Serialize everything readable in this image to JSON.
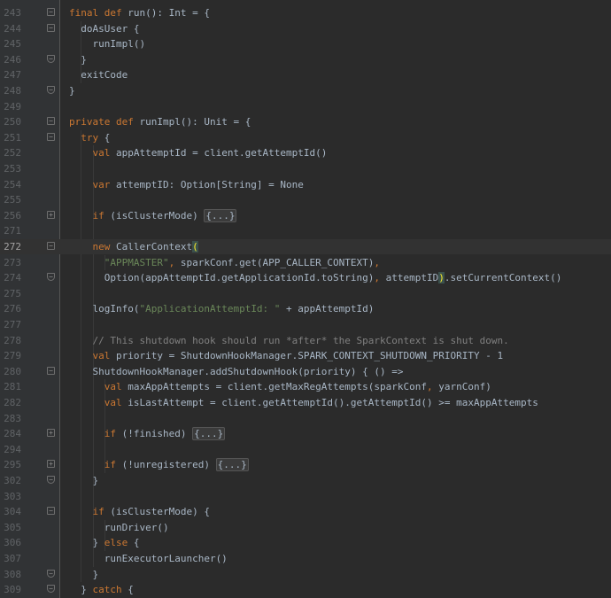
{
  "editor": {
    "lines": [
      {
        "num": "243",
        "fold": "start",
        "tokens": [
          {
            "t": "kw",
            "v": "final def "
          },
          {
            "t": "id",
            "v": "run(): Int = {"
          }
        ]
      },
      {
        "num": "244",
        "fold": "start",
        "tokens": [
          {
            "t": "id",
            "v": "  doAsUser {"
          }
        ]
      },
      {
        "num": "245",
        "fold": "",
        "tokens": [
          {
            "t": "id",
            "v": "    runImpl()"
          }
        ]
      },
      {
        "num": "246",
        "fold": "end",
        "tokens": [
          {
            "t": "id",
            "v": "  }"
          }
        ]
      },
      {
        "num": "247",
        "fold": "",
        "tokens": [
          {
            "t": "id",
            "v": "  exitCode"
          }
        ]
      },
      {
        "num": "248",
        "fold": "end",
        "tokens": [
          {
            "t": "id",
            "v": "}"
          }
        ]
      },
      {
        "num": "249",
        "fold": "",
        "tokens": []
      },
      {
        "num": "250",
        "fold": "start",
        "tokens": [
          {
            "t": "kw",
            "v": "private def "
          },
          {
            "t": "id",
            "v": "runImpl(): Unit = {"
          }
        ]
      },
      {
        "num": "251",
        "fold": "start",
        "tokens": [
          {
            "t": "kw",
            "v": "  try "
          },
          {
            "t": "id",
            "v": "{"
          }
        ]
      },
      {
        "num": "252",
        "fold": "",
        "tokens": [
          {
            "t": "kw",
            "v": "    val "
          },
          {
            "t": "id",
            "v": "appAttemptId = client.getAttemptId()"
          }
        ]
      },
      {
        "num": "253",
        "fold": "",
        "tokens": []
      },
      {
        "num": "254",
        "fold": "",
        "tokens": [
          {
            "t": "kw",
            "v": "    var "
          },
          {
            "t": "id",
            "v": "attemptID: Option[String] = None"
          }
        ]
      },
      {
        "num": "255",
        "fold": "",
        "tokens": []
      },
      {
        "num": "256",
        "fold": "plus",
        "tokens": [
          {
            "t": "kw",
            "v": "    if "
          },
          {
            "t": "id",
            "v": "(isClusterMode) "
          },
          {
            "t": "folded",
            "v": "{...}"
          }
        ]
      },
      {
        "num": "271",
        "fold": "",
        "tokens": []
      },
      {
        "num": "272",
        "fold": "start",
        "current": true,
        "tokens": [
          {
            "t": "kw",
            "v": "    new "
          },
          {
            "t": "id",
            "v": "CallerContext"
          },
          {
            "t": "bracket",
            "v": "("
          }
        ]
      },
      {
        "num": "273",
        "fold": "",
        "tokens": [
          {
            "t": "str",
            "v": "      \"APPMASTER\""
          },
          {
            "t": "kw",
            "v": ", "
          },
          {
            "t": "id",
            "v": "sparkConf.get(APP_CALLER_CONTEXT)"
          },
          {
            "t": "kw",
            "v": ","
          }
        ]
      },
      {
        "num": "274",
        "fold": "end",
        "tokens": [
          {
            "t": "id",
            "v": "      Option(appAttemptId.getApplicationId.toString)"
          },
          {
            "t": "kw",
            "v": ", "
          },
          {
            "t": "id",
            "v": "attemptID"
          },
          {
            "t": "bracket",
            "v": ")"
          },
          {
            "t": "id",
            "v": ".setCurrentContext()"
          }
        ]
      },
      {
        "num": "275",
        "fold": "",
        "tokens": []
      },
      {
        "num": "276",
        "fold": "",
        "tokens": [
          {
            "t": "id",
            "v": "    logInfo("
          },
          {
            "t": "str",
            "v": "\"ApplicationAttemptId: \""
          },
          {
            "t": "id",
            "v": " + appAttemptId)"
          }
        ]
      },
      {
        "num": "277",
        "fold": "",
        "tokens": []
      },
      {
        "num": "278",
        "fold": "",
        "tokens": [
          {
            "t": "cmt",
            "v": "    // This shutdown hook should run *after* the SparkContext is shut down."
          }
        ]
      },
      {
        "num": "279",
        "fold": "",
        "tokens": [
          {
            "t": "kw",
            "v": "    val "
          },
          {
            "t": "id",
            "v": "priority = ShutdownHookManager.SPARK_CONTEXT_SHUTDOWN_PRIORITY - 1"
          }
        ]
      },
      {
        "num": "280",
        "fold": "start",
        "tokens": [
          {
            "t": "id",
            "v": "    ShutdownHookManager.addShutdownHook(priority) { () =>"
          }
        ]
      },
      {
        "num": "281",
        "fold": "",
        "tokens": [
          {
            "t": "kw",
            "v": "      val "
          },
          {
            "t": "id",
            "v": "maxAppAttempts = client.getMaxRegAttempts(sparkConf"
          },
          {
            "t": "kw",
            "v": ", "
          },
          {
            "t": "id",
            "v": "yarnConf)"
          }
        ]
      },
      {
        "num": "282",
        "fold": "",
        "tokens": [
          {
            "t": "kw",
            "v": "      val "
          },
          {
            "t": "id",
            "v": "isLastAttempt = client.getAttemptId().getAttemptId() >= maxAppAttempts"
          }
        ]
      },
      {
        "num": "283",
        "fold": "",
        "tokens": []
      },
      {
        "num": "284",
        "fold": "plus",
        "tokens": [
          {
            "t": "kw",
            "v": "      if "
          },
          {
            "t": "id",
            "v": "(!finished) "
          },
          {
            "t": "folded",
            "v": "{...}"
          }
        ]
      },
      {
        "num": "294",
        "fold": "",
        "tokens": []
      },
      {
        "num": "295",
        "fold": "plus",
        "tokens": [
          {
            "t": "kw",
            "v": "      if "
          },
          {
            "t": "id",
            "v": "(!unregistered) "
          },
          {
            "t": "folded",
            "v": "{...}"
          }
        ]
      },
      {
        "num": "302",
        "fold": "end",
        "tokens": [
          {
            "t": "id",
            "v": "    }"
          }
        ]
      },
      {
        "num": "303",
        "fold": "",
        "tokens": []
      },
      {
        "num": "304",
        "fold": "start",
        "tokens": [
          {
            "t": "kw",
            "v": "    if "
          },
          {
            "t": "id",
            "v": "(isClusterMode) {"
          }
        ]
      },
      {
        "num": "305",
        "fold": "",
        "tokens": [
          {
            "t": "id",
            "v": "      runDriver()"
          }
        ]
      },
      {
        "num": "306",
        "fold": "",
        "tokens": [
          {
            "t": "id",
            "v": "    } "
          },
          {
            "t": "kw",
            "v": "else "
          },
          {
            "t": "id",
            "v": "{"
          }
        ]
      },
      {
        "num": "307",
        "fold": "",
        "tokens": [
          {
            "t": "id",
            "v": "      runExecutorLauncher()"
          }
        ]
      },
      {
        "num": "308",
        "fold": "end",
        "tokens": [
          {
            "t": "id",
            "v": "    }"
          }
        ]
      },
      {
        "num": "309",
        "fold": "end",
        "tokens": [
          {
            "t": "id",
            "v": "  } "
          },
          {
            "t": "kw",
            "v": "catch "
          },
          {
            "t": "id",
            "v": "{"
          }
        ]
      }
    ]
  },
  "colors": {
    "background": "#2b2b2b",
    "gutter": "#313335",
    "keyword": "#cc7832",
    "string": "#6a8759",
    "comment": "#808080",
    "identifier": "#a9b7c6",
    "line_number": "#606366",
    "matched_bracket": "#ffef28"
  }
}
